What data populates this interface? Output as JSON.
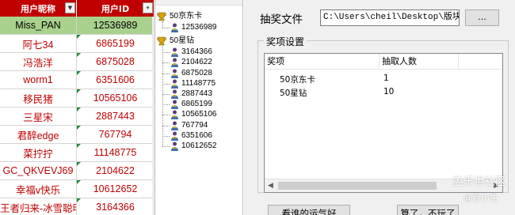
{
  "sheet": {
    "headers": [
      "用户昵称",
      "用户ID"
    ],
    "rows": [
      [
        "Miss_PAN",
        "12536989"
      ],
      [
        "阿七34",
        "6865199"
      ],
      [
        "冯浩洋",
        "6875028"
      ],
      [
        "worm1",
        "6351606"
      ],
      [
        "移民猪",
        "10565106"
      ],
      [
        "三星宋",
        "2887443"
      ],
      [
        "君醉edge",
        "767794"
      ],
      [
        "菜拧拧",
        "11148775"
      ],
      [
        "GC_QKVEVJ69",
        "2104622"
      ],
      [
        "幸福v快乐",
        "10612652"
      ],
      [
        "王者归来-冰雪聪明",
        "3164366"
      ]
    ],
    "colors": {
      "header_bg": "#c00000",
      "highlight_row": "#a9d18e",
      "cell_text": "#c00000"
    }
  },
  "tree": {
    "nodes": [
      {
        "label": "50京东卡",
        "children": [
          "12536989"
        ]
      },
      {
        "label": "50星钻",
        "children": [
          "3164366",
          "2104622",
          "6875028",
          "11148775",
          "2887443",
          "6865199",
          "10565106",
          "767794",
          "6351606",
          "10612652"
        ]
      }
    ],
    "icons": {
      "group": "trophy-icon",
      "member": "person-icon"
    }
  },
  "dialog": {
    "file_label": "抽奖文件",
    "file_path": "C:\\Users\\cheil\\Desktop\\版块活",
    "browse_label": "...",
    "group_title": "奖项设置",
    "columns": [
      "奖项",
      "抽取人数"
    ],
    "prizes": [
      {
        "name": "50京东卡",
        "count": "1"
      },
      {
        "name": "50星钻",
        "count": "10"
      }
    ],
    "luck_button": "看谁的运气好",
    "quit_button": "算了，不玩了"
  },
  "watermark": {
    "line1": "盖乐世社区",
    "line2": "@百小生"
  }
}
